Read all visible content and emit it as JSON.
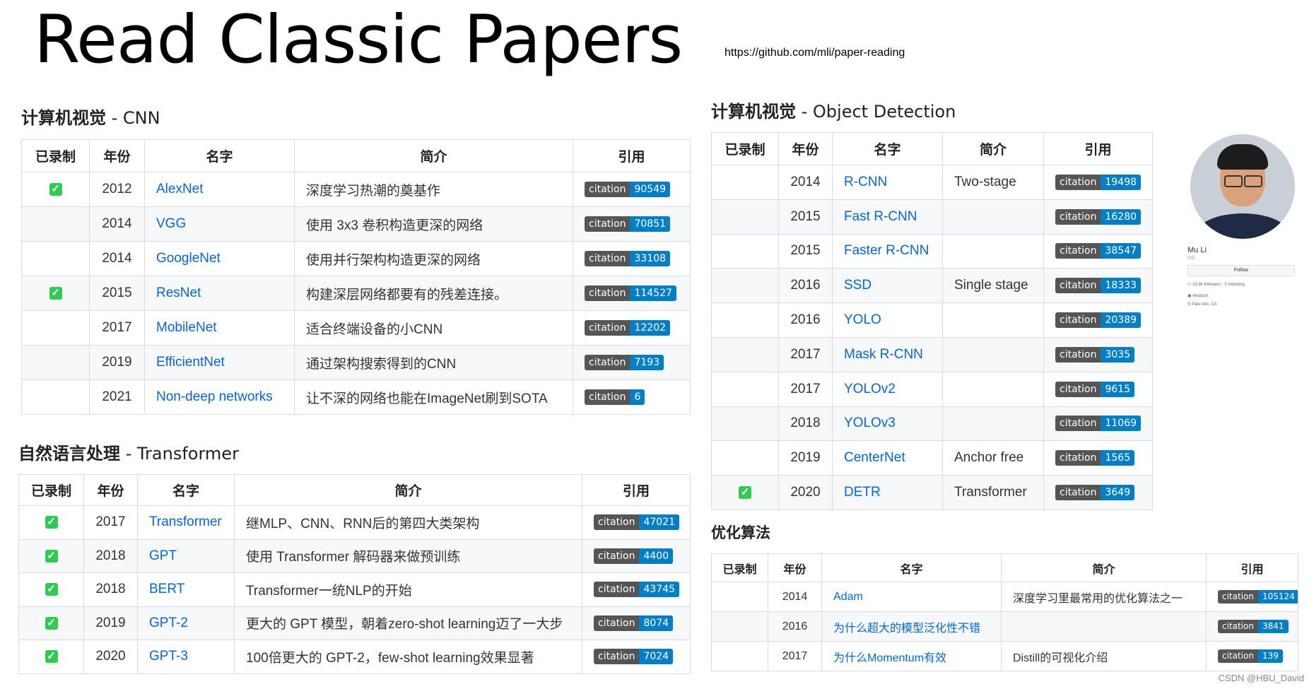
{
  "page": {
    "title": "Read Classic Papers",
    "repo_url": "https://github.com/mli/paper-reading",
    "watermark": "CSDN @HBU_David"
  },
  "badge_label": "citation",
  "colors": {
    "link": "#0366d6",
    "badge_value": "#007ec6",
    "badge_label": "#555555",
    "check": "#2ecc52"
  },
  "icons": {
    "recorded": "check-icon"
  },
  "cnn": {
    "title_cn": "计算机视觉",
    "title_en": " - CNN",
    "headers": [
      "已录制",
      "年份",
      "名字",
      "简介",
      "引用"
    ],
    "rows": [
      {
        "recorded": true,
        "year": "2012",
        "name": "AlexNet",
        "desc": "深度学习热潮的奠基作",
        "citation": "90549"
      },
      {
        "recorded": false,
        "year": "2014",
        "name": "VGG",
        "desc": "使用 3x3 卷积构造更深的网络",
        "citation": "70851"
      },
      {
        "recorded": false,
        "year": "2014",
        "name": "GoogleNet",
        "desc": "使用并行架构构造更深的网络",
        "citation": "33108"
      },
      {
        "recorded": true,
        "year": "2015",
        "name": "ResNet",
        "desc": "构建深层网络都要有的残差连接。",
        "citation": "114527"
      },
      {
        "recorded": false,
        "year": "2017",
        "name": "MobileNet",
        "desc": "适合终端设备的小CNN",
        "citation": "12202"
      },
      {
        "recorded": false,
        "year": "2019",
        "name": "EfficientNet",
        "desc": "通过架构搜索得到的CNN",
        "citation": "7193"
      },
      {
        "recorded": false,
        "year": "2021",
        "name": "Non-deep networks",
        "desc": "让不深的网络也能在ImageNet刷到SOTA",
        "citation": "6"
      }
    ]
  },
  "nlp": {
    "title_cn": "自然语言处理",
    "title_en": " - Transformer",
    "headers": [
      "已录制",
      "年份",
      "名字",
      "简介",
      "引用"
    ],
    "rows": [
      {
        "recorded": true,
        "year": "2017",
        "name": "Transformer",
        "desc": "继MLP、CNN、RNN后的第四大类架构",
        "citation": "47021"
      },
      {
        "recorded": true,
        "year": "2018",
        "name": "GPT",
        "desc": "使用 Transformer 解码器来做预训练",
        "citation": "4400"
      },
      {
        "recorded": true,
        "year": "2018",
        "name": "BERT",
        "desc": "Transformer一统NLP的开始",
        "citation": "43745"
      },
      {
        "recorded": true,
        "year": "2019",
        "name": "GPT-2",
        "desc": "更大的 GPT 模型，朝着zero-shot learning迈了一大步",
        "citation": "8074"
      },
      {
        "recorded": true,
        "year": "2020",
        "name": "GPT-3",
        "desc": "100倍更大的 GPT-2，few-shot learning效果显著",
        "citation": "7024"
      }
    ]
  },
  "det": {
    "title_cn": "计算机视觉",
    "title_en": " - Object Detection",
    "headers": [
      "已录制",
      "年份",
      "名字",
      "简介",
      "引用"
    ],
    "rows": [
      {
        "recorded": false,
        "year": "2014",
        "name": "R-CNN",
        "desc": "Two-stage",
        "citation": "19498"
      },
      {
        "recorded": false,
        "year": "2015",
        "name": "Fast R-CNN",
        "desc": "",
        "citation": "16280"
      },
      {
        "recorded": false,
        "year": "2015",
        "name": "Faster R-CNN",
        "desc": "",
        "citation": "38547"
      },
      {
        "recorded": false,
        "year": "2016",
        "name": "SSD",
        "desc": "Single stage",
        "citation": "18333"
      },
      {
        "recorded": false,
        "year": "2016",
        "name": "YOLO",
        "desc": "",
        "citation": "20389"
      },
      {
        "recorded": false,
        "year": "2017",
        "name": "Mask R-CNN",
        "desc": "",
        "citation": "3035"
      },
      {
        "recorded": false,
        "year": "2017",
        "name": "YOLOv2",
        "desc": "",
        "citation": "9615"
      },
      {
        "recorded": false,
        "year": "2018",
        "name": "YOLOv3",
        "desc": "",
        "citation": "11069"
      },
      {
        "recorded": false,
        "year": "2019",
        "name": "CenterNet",
        "desc": "Anchor free",
        "citation": "1565"
      },
      {
        "recorded": true,
        "year": "2020",
        "name": "DETR",
        "desc": "Transformer",
        "citation": "3649"
      }
    ]
  },
  "opt": {
    "title_cn": "优化算法",
    "title_en": "",
    "headers": [
      "已录制",
      "年份",
      "名字",
      "简介",
      "引用"
    ],
    "rows": [
      {
        "recorded": false,
        "year": "2014",
        "name": "Adam",
        "desc": "深度学习里最常用的优化算法之一",
        "citation": "105124"
      },
      {
        "recorded": false,
        "year": "2016",
        "name": "为什么超大的模型泛化性不错",
        "desc": "",
        "citation": "3841"
      },
      {
        "recorded": false,
        "year": "2017",
        "name": "为什么Momentum有效",
        "desc": "Distill的可视化介绍",
        "citation": "139"
      }
    ]
  },
  "profile": {
    "name": "Mu Li",
    "login": "mli",
    "follow_label": "Follow",
    "followers": "13.9k followers · 0 following",
    "company": "Amazon",
    "location": "Palo Alto, CA"
  }
}
